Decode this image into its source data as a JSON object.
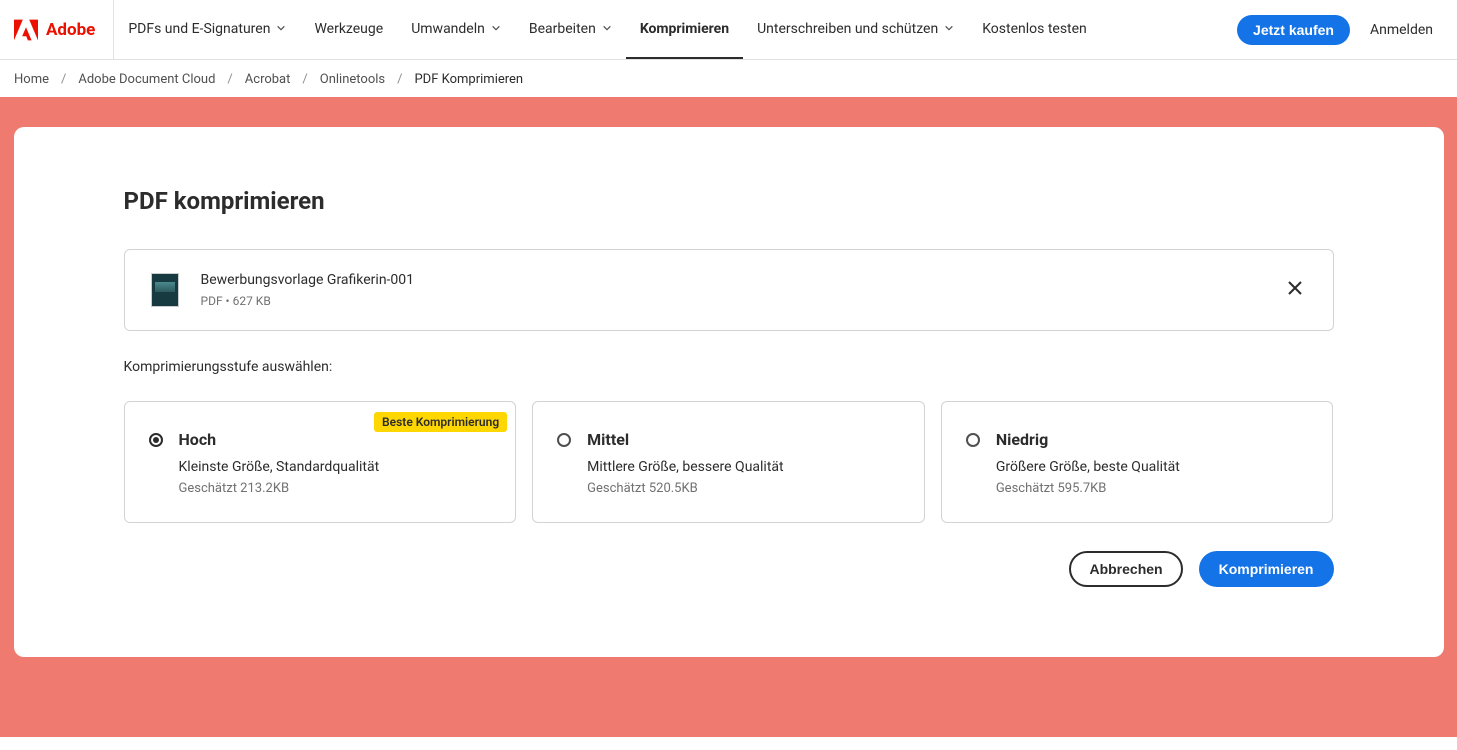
{
  "brand": "Adobe",
  "nav": {
    "items": [
      {
        "label": "PDFs und E-Signaturen",
        "dropdown": true
      },
      {
        "label": "Werkzeuge",
        "dropdown": false
      },
      {
        "label": "Umwandeln",
        "dropdown": true
      },
      {
        "label": "Bearbeiten",
        "dropdown": true
      },
      {
        "label": "Komprimieren",
        "dropdown": false,
        "active": true
      },
      {
        "label": "Unterschreiben und schützen",
        "dropdown": true
      },
      {
        "label": "Kostenlos testen",
        "dropdown": false
      }
    ],
    "buy_label": "Jetzt kaufen",
    "login_label": "Anmelden"
  },
  "breadcrumbs": {
    "items": [
      "Home",
      "Adobe Document Cloud",
      "Acrobat",
      "Onlinetools"
    ],
    "current": "PDF Komprimieren"
  },
  "page": {
    "title": "PDF komprimieren",
    "file": {
      "name": "Bewerbungsvorlage Grafikerin-001",
      "meta": "PDF • 627 KB"
    },
    "select_label": "Komprimierungsstufe auswählen:",
    "options": [
      {
        "title": "Hoch",
        "desc": "Kleinste Größe, Standardqualität",
        "estimate": "Geschätzt 213.2KB",
        "badge": "Beste Komprimierung",
        "selected": true
      },
      {
        "title": "Mittel",
        "desc": "Mittlere Größe, bessere Qualität",
        "estimate": "Geschätzt 520.5KB",
        "selected": false
      },
      {
        "title": "Niedrig",
        "desc": "Größere Größe, beste Qualität",
        "estimate": "Geschätzt 595.7KB",
        "selected": false
      }
    ],
    "cancel_label": "Abbrechen",
    "compress_label": "Komprimieren"
  }
}
